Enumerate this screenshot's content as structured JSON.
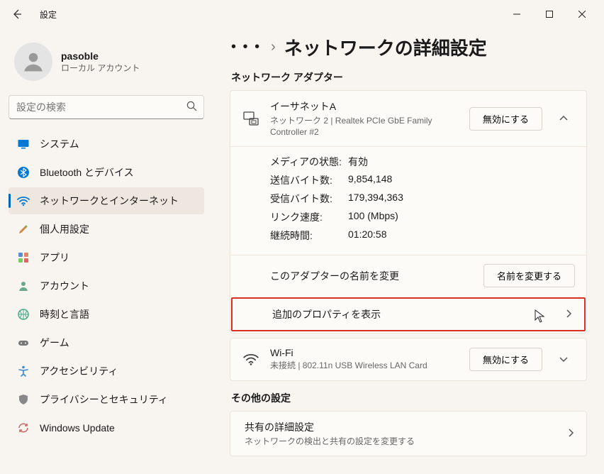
{
  "titlebar": {
    "title": "設定"
  },
  "user": {
    "name": "pasoble",
    "subtitle": "ローカル アカウント"
  },
  "search": {
    "placeholder": "設定の検索"
  },
  "nav": [
    {
      "label": "システム"
    },
    {
      "label": "Bluetooth とデバイス"
    },
    {
      "label": "ネットワークとインターネット"
    },
    {
      "label": "個人用設定"
    },
    {
      "label": "アプリ"
    },
    {
      "label": "アカウント"
    },
    {
      "label": "時刻と言語"
    },
    {
      "label": "ゲーム"
    },
    {
      "label": "アクセシビリティ"
    },
    {
      "label": "プライバシーとセキュリティ"
    },
    {
      "label": "Windows Update"
    }
  ],
  "page": {
    "title": "ネットワークの詳細設定",
    "adapters_label": "ネットワーク アダプター",
    "other_label": "その他の設定"
  },
  "adapter1": {
    "name": "イーサネットA",
    "sub": "ネットワーク 2 | Realtek PCIe GbE Family Controller #2",
    "disable_btn": "無効にする",
    "rename_label": "このアダプターの名前を変更",
    "rename_btn": "名前を変更する",
    "props_label": "追加のプロパティを表示",
    "details": {
      "media_label": "メディアの状態:",
      "media_value": "有効",
      "sent_label": "送信バイト数:",
      "sent_value": "9,854,148",
      "recv_label": "受信バイト数:",
      "recv_value": "179,394,363",
      "speed_label": "リンク速度:",
      "speed_value": "100 (Mbps)",
      "duration_label": "継続時間:",
      "duration_value": "01:20:58"
    }
  },
  "adapter2": {
    "name": "Wi-Fi",
    "sub": "未接続 | 802.11n USB Wireless LAN Card",
    "disable_btn": "無効にする"
  },
  "sharing": {
    "title": "共有の詳細設定",
    "sub": "ネットワークの検出と共有の設定を変更する"
  }
}
